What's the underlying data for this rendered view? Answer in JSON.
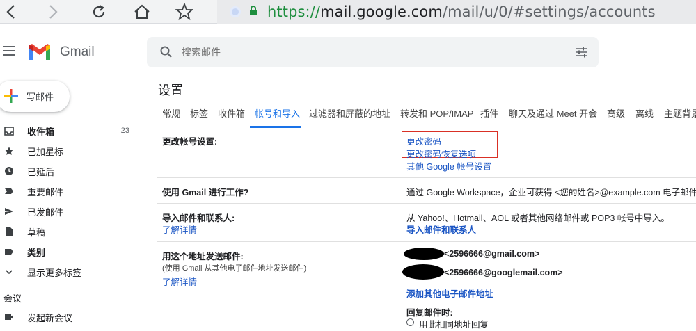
{
  "browser": {
    "url_scheme": "https://",
    "url_host": "mail.google.com",
    "url_path": "/mail/u/0/#settings/accounts"
  },
  "header": {
    "app_name": "Gmail",
    "search_placeholder": "搜索邮件"
  },
  "sidebar": {
    "compose_label": "写邮件",
    "items": [
      {
        "label": "收件箱",
        "count": "23",
        "icon": "inbox-icon"
      },
      {
        "label": "已加星标",
        "icon": "star-icon"
      },
      {
        "label": "已延后",
        "icon": "clock-icon"
      },
      {
        "label": "重要邮件",
        "icon": "label-important-icon"
      },
      {
        "label": "已发邮件",
        "icon": "send-icon"
      },
      {
        "label": "草稿",
        "icon": "draft-icon"
      },
      {
        "label": "类别",
        "icon": "label-icon"
      },
      {
        "label": "显示更多标签",
        "icon": "chevron-down-icon"
      }
    ],
    "meet_title": "会议",
    "meet_item": "发起新会议"
  },
  "settings": {
    "title": "设置",
    "tabs": [
      "常规",
      "标签",
      "收件箱",
      "帐号和导入",
      "过滤器和屏蔽的地址",
      "转发和 POP/IMAP",
      "插件",
      "聊天及通过 Meet 开会",
      "高级",
      "离线",
      "主题背景"
    ],
    "active_tab": "帐号和导入",
    "rows": {
      "change_account": {
        "label": "更改帐号设置:",
        "links": [
          "更改密码",
          "更改密码恢复选项",
          "其他 Google 帐号设置"
        ]
      },
      "workspace": {
        "label": "使用 Gmail 进行工作?",
        "text": "通过 Google Workspace，企业可获得 <您的姓名>@example.com 电子邮件"
      },
      "import": {
        "label": "导入邮件和联系人:",
        "learn_more": "了解详情",
        "text": "从 Yahoo!、Hotmail、AOL 或者其他网络邮件或 POP3 帐号中导入。",
        "action": "导入邮件和联系人"
      },
      "send_as": {
        "label": "用这个地址发送邮件:",
        "sub": "(使用 Gmail 从其他电子邮件地址发送邮件)",
        "learn_more": "了解详情",
        "emails": [
          "<2596666@gmail.com>",
          "<2596666@googlemail.com>"
        ],
        "add_link": "添加其他电子邮件地址",
        "reply_label": "回复邮件时:",
        "reply_option": "用此相同地址回复"
      }
    }
  },
  "colors": {
    "link": "#1a55c4",
    "active_tab": "#1a73e8",
    "highlight_box": "#d93025"
  }
}
